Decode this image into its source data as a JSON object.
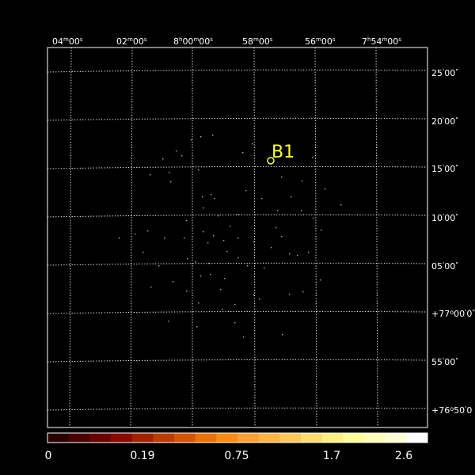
{
  "top_ra_labels": [
    {
      "h": "",
      "m": "04",
      "s": "00"
    },
    {
      "h": "",
      "m": "02",
      "s": "00"
    },
    {
      "h": "8",
      "m": "00",
      "s": "00"
    },
    {
      "h": "",
      "m": "58",
      "s": "00"
    },
    {
      "h": "",
      "m": "56",
      "s": "00"
    },
    {
      "h": "7",
      "m": "54",
      "s": "00"
    }
  ],
  "right_dec_labels": [
    {
      "deg": "",
      "min": "25",
      "sec": "00"
    },
    {
      "deg": "",
      "min": "20",
      "sec": "00"
    },
    {
      "deg": "",
      "min": "15",
      "sec": "00"
    },
    {
      "deg": "",
      "min": "10",
      "sec": "00"
    },
    {
      "deg": "",
      "min": "05",
      "sec": "00"
    },
    {
      "deg": "+77",
      "min": "00",
      "sec": "0"
    },
    {
      "deg": "",
      "min": "55",
      "sec": "00"
    },
    {
      "deg": "+76",
      "min": "50",
      "sec": "0"
    }
  ],
  "source": {
    "label": "B1",
    "color": "#ffff33"
  },
  "colorbar": {
    "tick_labels": [
      "0",
      "0.19",
      "0.75",
      "1.7",
      "2.6"
    ],
    "colors": [
      "#2a0000",
      "#4a0000",
      "#6a0000",
      "#8c0a00",
      "#a52000",
      "#bd3a00",
      "#d55400",
      "#ee7000",
      "#ff8c10",
      "#ffa030",
      "#ffb444",
      "#ffc858",
      "#ffdc6c",
      "#fff07f",
      "#ffff9a",
      "#ffffb8",
      "#ffffd6",
      "#ffffff"
    ]
  },
  "photons": [
    [
      241,
      176
    ],
    [
      253,
      172
    ],
    [
      268,
      170
    ],
    [
      222,
      190
    ],
    [
      205,
      200
    ],
    [
      189,
      220
    ],
    [
      215,
      229
    ],
    [
      250,
      214
    ],
    [
      306,
      192
    ],
    [
      318,
      181
    ],
    [
      355,
      223
    ],
    [
      381,
      228
    ],
    [
      410,
      238
    ],
    [
      430,
      258
    ],
    [
      300,
      270
    ],
    [
      266,
      245
    ],
    [
      255,
      248
    ],
    [
      256,
      262
    ],
    [
      270,
      250
    ],
    [
      310,
      240
    ],
    [
      330,
      250
    ],
    [
      350,
      265
    ],
    [
      367,
      248
    ],
    [
      380,
      265
    ],
    [
      395,
      275
    ],
    [
      405,
      290
    ],
    [
      235,
      278
    ],
    [
      275,
      272
    ],
    [
      290,
      285
    ],
    [
      300,
      300
    ],
    [
      320,
      305
    ],
    [
      355,
      298
    ],
    [
      342,
      312
    ],
    [
      150,
      300
    ],
    [
      170,
      295
    ],
    [
      186,
      291
    ],
    [
      207,
      300
    ],
    [
      232,
      300
    ],
    [
      256,
      292
    ],
    [
      269,
      297
    ],
    [
      282,
      303
    ],
    [
      246,
      330
    ],
    [
      263,
      332
    ],
    [
      265,
      346
    ],
    [
      283,
      351
    ],
    [
      253,
      348
    ],
    [
      278,
      365
    ],
    [
      300,
      325
    ],
    [
      312,
      335
    ],
    [
      333,
      338
    ],
    [
      365,
      320
    ],
    [
      375,
      322
    ],
    [
      389,
      318
    ],
    [
      404,
      353
    ],
    [
      382,
      368
    ],
    [
      365,
      371
    ],
    [
      320,
      372
    ],
    [
      180,
      318
    ],
    [
      200,
      335
    ],
    [
      218,
      355
    ],
    [
      235,
      367
    ],
    [
      250,
      382
    ],
    [
      280,
      390
    ],
    [
      296,
      407
    ],
    [
      307,
      425
    ],
    [
      356,
      422
    ],
    [
      212,
      405
    ],
    [
      248,
      412
    ],
    [
      327,
      377
    ],
    [
      296,
      384
    ],
    [
      236,
      326
    ],
    [
      190,
      362
    ],
    [
      286,
      317
    ],
    [
      348,
      287
    ],
    [
      394,
      198
    ],
    [
      229,
      196
    ],
    [
      213,
      217
    ],
    [
      262,
      306
    ]
  ]
}
